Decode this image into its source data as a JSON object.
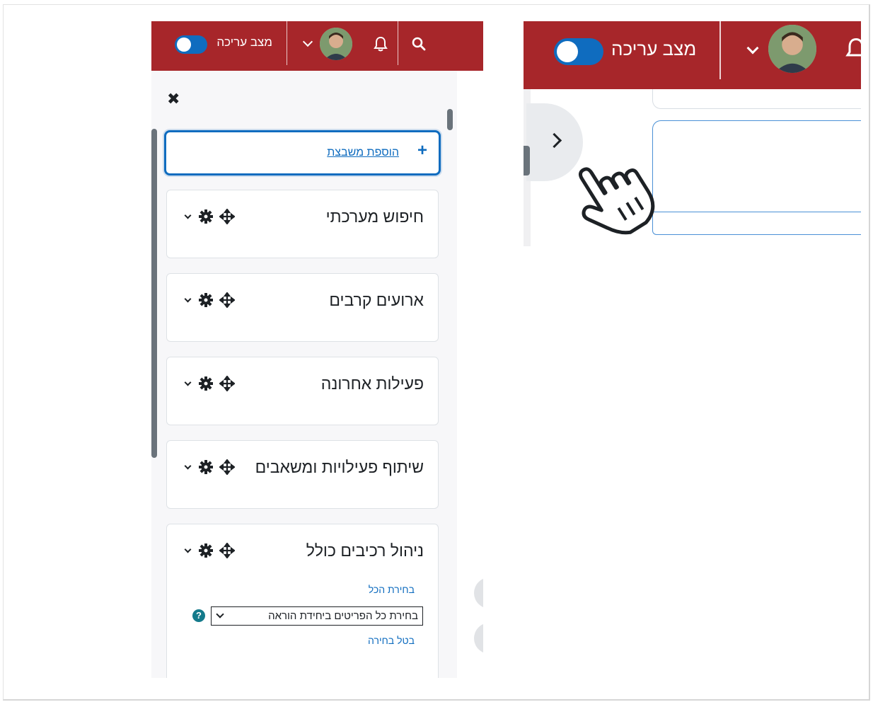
{
  "navbar": {
    "edit_mode_label": "מצב עריכה"
  },
  "drawer": {
    "add_block_label": "הוספת משבצת",
    "blocks": [
      {
        "title": "חיפוש מערכתי"
      },
      {
        "title": "ארועים קרבים"
      },
      {
        "title": "פעילות אחרונה"
      },
      {
        "title": "שיתוף פעילויות ומשאבים"
      },
      {
        "title": "ניהול רכיבים כולל"
      }
    ],
    "bulk": {
      "select_all_label": "בחירת הכל",
      "select_value": "בחירת כל הפריטים ביחידת הוראה",
      "deselect_label": "בטל בחירה",
      "help_glyph": "?"
    }
  },
  "icons": {
    "close": "close-icon",
    "plus": "plus-icon",
    "gear": "gear-icon",
    "move": "move-icon",
    "bell": "bell-icon",
    "search": "search-icon",
    "chevron_right": "chevron-right-icon",
    "hand_cursor": "hand-pointer-icon"
  },
  "colors": {
    "navbar": "#a7262a",
    "primary": "#0f6cbf",
    "drawer_bg": "#f7f7f9",
    "help": "#147a8b"
  }
}
